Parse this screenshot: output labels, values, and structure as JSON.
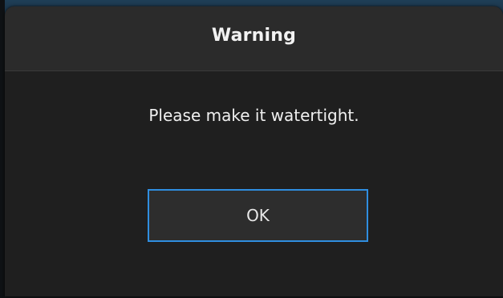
{
  "dialog": {
    "title": "Warning",
    "message": "Please make it watertight.",
    "ok_label": "OK"
  },
  "colors": {
    "dialog_background": "#1f1f1f",
    "header_background": "#2b2b2b",
    "button_border_accent": "#2f8ee0",
    "text": "#f0f0f0"
  }
}
